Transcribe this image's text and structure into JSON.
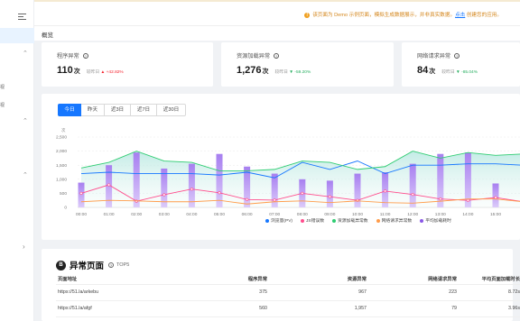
{
  "sidebar": {
    "labels": [
      "视",
      "视"
    ]
  },
  "topbar": {
    "notice_text": "该页面为 Demo 示例页面，模拟生成数据展示，并非真实数据。",
    "notice_link": "点击",
    "notice_tail": " 创建您的应用。"
  },
  "breadcrumb": {
    "title": "概览"
  },
  "stats": [
    {
      "title": "程序异常",
      "value": "110",
      "unit": "次",
      "cmp_label": "较昨日",
      "change": "+42.82%",
      "trend": "up"
    },
    {
      "title": "资源加载异常",
      "value": "1,276",
      "unit": "次",
      "cmp_label": "较昨日",
      "change": "-59.20%",
      "trend": "down"
    },
    {
      "title": "网络请求异常",
      "value": "84",
      "unit": "次",
      "cmp_label": "较昨日",
      "change": "-85.04%",
      "trend": "down"
    }
  ],
  "tabs": [
    "今日",
    "昨天",
    "近3日",
    "近7日",
    "近30日"
  ],
  "active_tab": 0,
  "colors": {
    "accent": "#1677ff",
    "pv": "#1677ff",
    "js": "#ff4d8d",
    "res": "#2ecc71",
    "net": "#ff9c4a",
    "avg": "#8a57e6",
    "bar": "#b892f0"
  },
  "chart_data": {
    "type": "bar-line-combo",
    "x": [
      "00:00",
      "01:00",
      "02:00",
      "03:00",
      "04:00",
      "05:00",
      "06:00",
      "07:00",
      "08:00",
      "09:00",
      "10:00",
      "11:00",
      "12:00",
      "13:00",
      "14:00",
      "15:00",
      "16:00"
    ],
    "y_unit": "次",
    "ylim": [
      0,
      2500
    ],
    "yticks": [
      "0",
      "500",
      "1,000",
      "1,500",
      "2,000",
      "2,500"
    ],
    "xticks": [
      "00:00",
      "01:00",
      "02:00",
      "03:00",
      "04:00",
      "05:00",
      "06:00",
      "07:00",
      "08:00",
      "09:00",
      "10:00",
      "11:00",
      "12:00",
      "13:00",
      "14:00",
      "15:00"
    ],
    "series": [
      {
        "name": "浏览量(PV)",
        "type": "line",
        "values": [
          1200,
          1250,
          1200,
          1200,
          1200,
          1150,
          1250,
          1050,
          1600,
          1350,
          1650,
          1200,
          1500,
          1500,
          1550,
          1550,
          1500
        ]
      },
      {
        "name": "JS错误数",
        "type": "line",
        "values": [
          500,
          800,
          220,
          450,
          650,
          520,
          280,
          260,
          500,
          380,
          250,
          580,
          460,
          300,
          250,
          350,
          200
        ]
      },
      {
        "name": "资源加载异常数",
        "type": "line",
        "values": [
          1400,
          1600,
          2000,
          1650,
          1600,
          1300,
          1300,
          1350,
          1650,
          1600,
          1350,
          1450,
          2000,
          1750,
          1950,
          1850,
          1900
        ]
      },
      {
        "name": "网络请求异常数",
        "type": "line",
        "values": [
          200,
          250,
          230,
          200,
          200,
          250,
          120,
          200,
          230,
          170,
          230,
          170,
          150,
          220,
          300,
          300,
          200
        ]
      },
      {
        "name": "平均加载耗时",
        "type": "bar",
        "values": [
          880,
          1500,
          1950,
          1380,
          1550,
          1900,
          1450,
          1200,
          1000,
          950,
          1200,
          1250,
          1550,
          1900,
          1950,
          850,
          1600
        ]
      }
    ],
    "legend_position": "bottom-right",
    "grid": true
  },
  "anomaly": {
    "icon_char": "B",
    "title": "异常页面",
    "badge": "TOP5",
    "headers": [
      "页面地址",
      "程序异常",
      "资源异常",
      "网络请求异常",
      "平均页面加载时长"
    ],
    "rows": [
      [
        "https://51.la/arkebu",
        "375",
        "967",
        "223",
        "8.72s"
      ],
      [
        "https://51.la/afgf",
        "560",
        "1,957",
        "79",
        "3.96s"
      ]
    ]
  }
}
